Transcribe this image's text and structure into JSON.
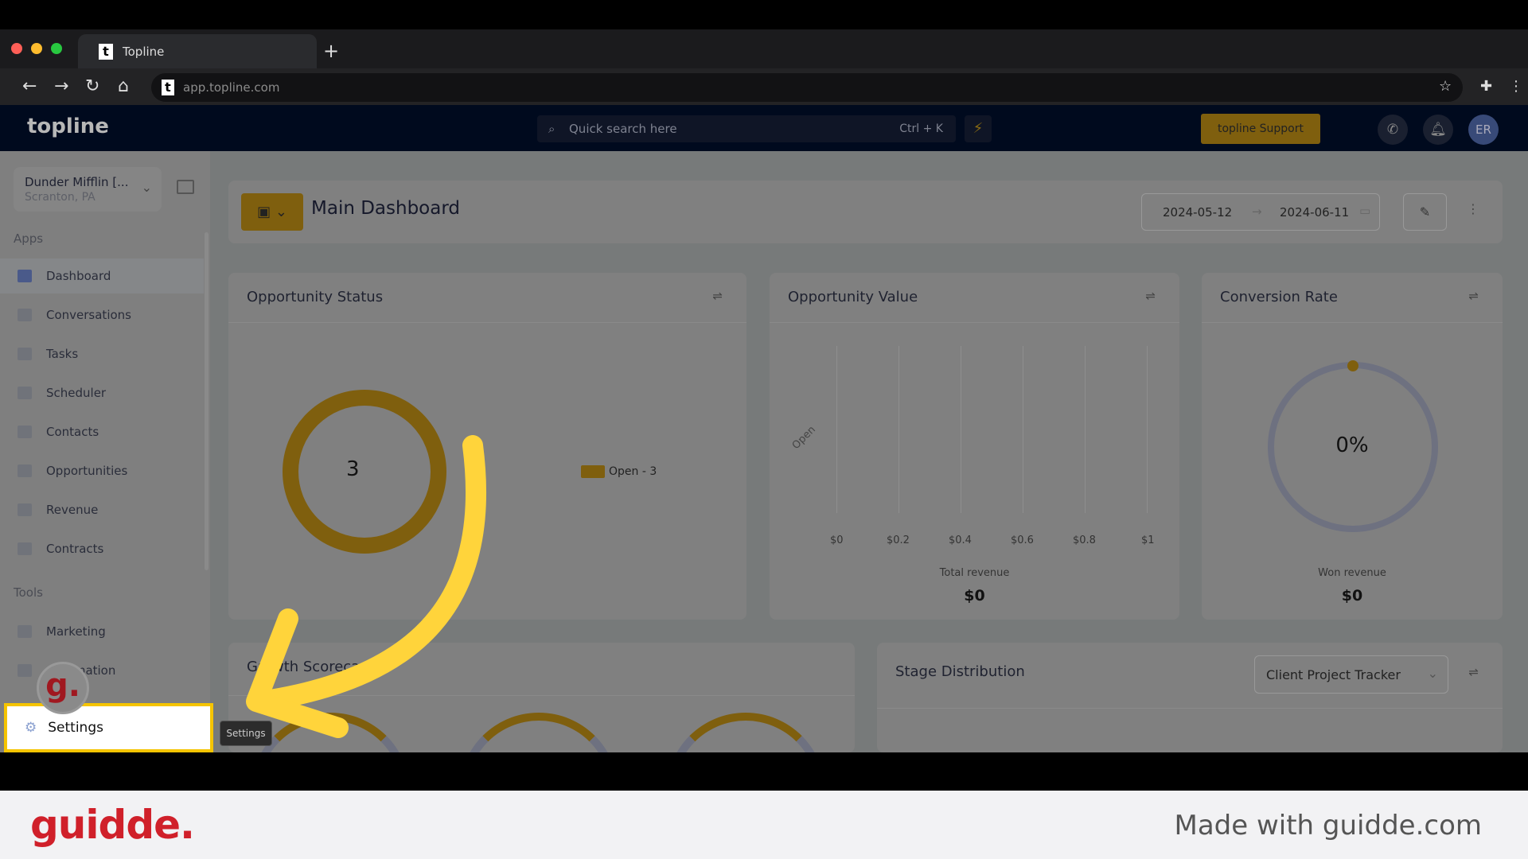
{
  "browser": {
    "tab_title": "Topline",
    "url": "app.topline.com"
  },
  "header": {
    "logo": "topline",
    "search_placeholder": "Quick search here",
    "search_shortcut": "Ctrl + K",
    "support_label": "topline Support",
    "avatar_initials": "ER"
  },
  "sidebar": {
    "location_name": "Dunder Mifflin [...",
    "location_sub": "Scranton, PA",
    "apps_label": "Apps",
    "apps": [
      {
        "label": "Dashboard",
        "active": true
      },
      {
        "label": "Conversations"
      },
      {
        "label": "Tasks"
      },
      {
        "label": "Scheduler"
      },
      {
        "label": "Contacts"
      },
      {
        "label": "Opportunities"
      },
      {
        "label": "Revenue"
      },
      {
        "label": "Contracts"
      }
    ],
    "tools_label": "Tools",
    "tools": [
      {
        "label": "Marketing"
      },
      {
        "label": "Automation"
      }
    ],
    "settings_label": "Settings",
    "settings_tooltip": "Settings"
  },
  "dashboard": {
    "title": "Main Dashboard",
    "date_start": "2024-05-12",
    "date_end": "2024-06-11"
  },
  "cards": {
    "opportunity_status": {
      "title": "Opportunity Status",
      "center_value": "3",
      "legend": "Open - 3",
      "color": "#7f5f0e"
    },
    "opportunity_value": {
      "title": "Opportunity Value",
      "y_label": "Open",
      "ticks": [
        "$0",
        "$0.2",
        "$0.4",
        "$0.6",
        "$0.8",
        "$1"
      ],
      "total_label": "Total revenue",
      "total_value": "$0"
    },
    "conversion_rate": {
      "title": "Conversion Rate",
      "value": "0%",
      "won_label": "Won revenue",
      "won_value": "$0"
    },
    "growth": {
      "title": "Growth Scorecard"
    },
    "stage_distribution": {
      "title": "Stage Distribution",
      "pipeline": "Client Project Tracker"
    }
  },
  "footer": {
    "brand": "guidde.",
    "made_with": "Made with guidde.com"
  },
  "colors": {
    "accent": "#f5c400",
    "brand_red": "#d0202a"
  }
}
